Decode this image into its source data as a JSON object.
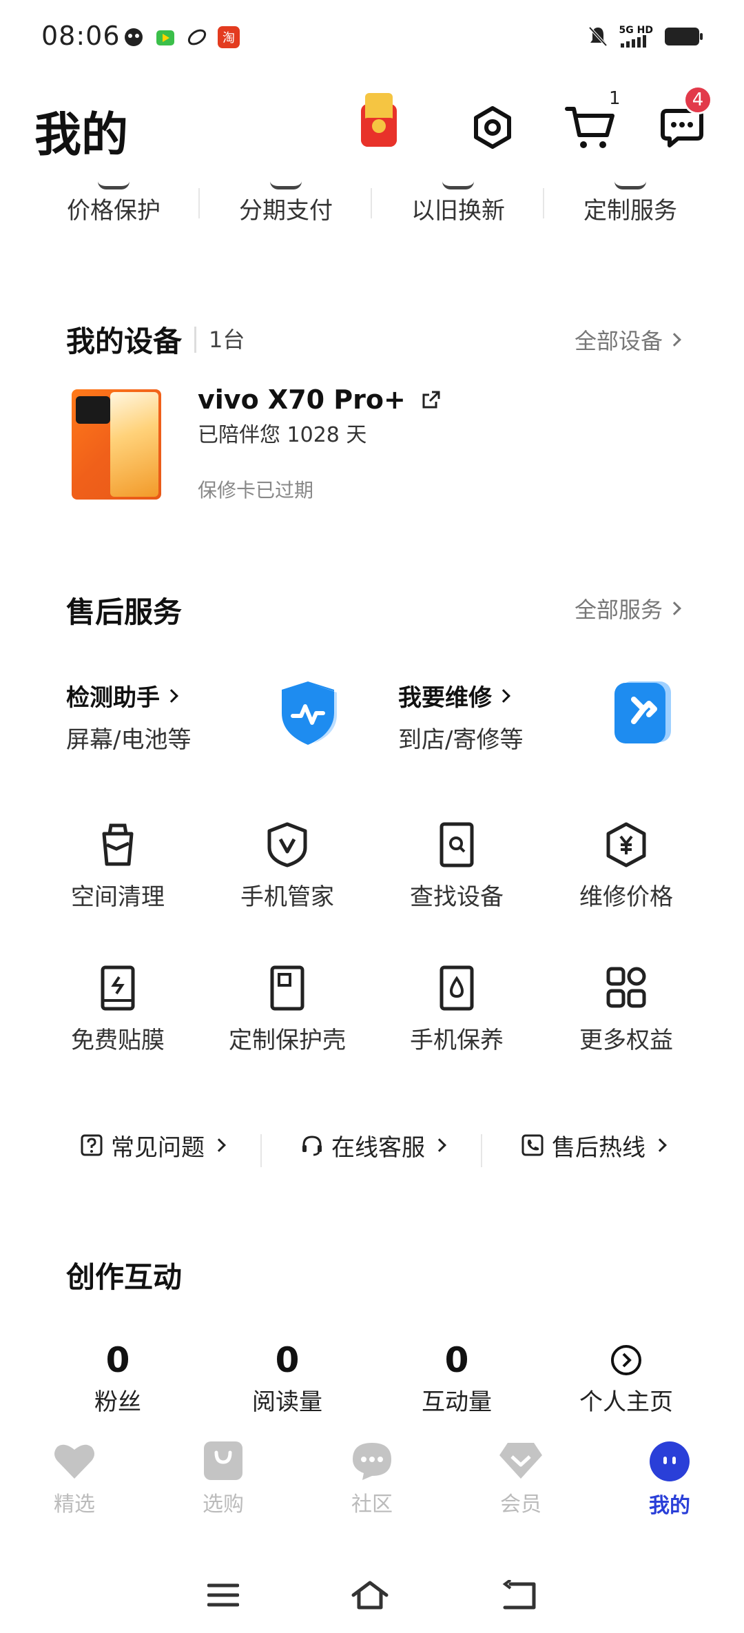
{
  "status_bar": {
    "time": "08:06",
    "network": "5G HD",
    "app_icon_text": "淘"
  },
  "header": {
    "title": "我的",
    "cart_count": "1",
    "message_count": "4"
  },
  "top_services": [
    {
      "label": "价格保护"
    },
    {
      "label": "分期支付"
    },
    {
      "label": "以旧换新"
    },
    {
      "label": "定制服务"
    }
  ],
  "devices": {
    "title": "我的设备",
    "count": "1台",
    "all_label": "全部设备",
    "device": {
      "name": "vivo X70 Pro+",
      "days": "已陪伴您 1028 天",
      "warranty": "保修卡已过期"
    }
  },
  "after_sales": {
    "title": "售后服务",
    "all_label": "全部服务",
    "cards": [
      {
        "title": "检测助手",
        "sub": "屏幕/电池等"
      },
      {
        "title": "我要维修",
        "sub": "到店/寄修等"
      }
    ],
    "grid": [
      {
        "label": "空间清理",
        "icon": "trash-icon"
      },
      {
        "label": "手机管家",
        "icon": "shield-v-icon"
      },
      {
        "label": "查找设备",
        "icon": "find-device-icon"
      },
      {
        "label": "维修价格",
        "icon": "yuan-hex-icon"
      },
      {
        "label": "免费贴膜",
        "icon": "screen-film-icon"
      },
      {
        "label": "定制保护壳",
        "icon": "phone-case-icon"
      },
      {
        "label": "手机保养",
        "icon": "droplet-phone-icon"
      },
      {
        "label": "更多权益",
        "icon": "grid-icon"
      }
    ],
    "help": [
      {
        "label": "常见问题",
        "icon": "question-icon"
      },
      {
        "label": "在线客服",
        "icon": "headset-icon"
      },
      {
        "label": "售后热线",
        "icon": "phone-call-icon"
      }
    ]
  },
  "creation": {
    "title": "创作互动",
    "stats": [
      {
        "value": "0",
        "label": "粉丝"
      },
      {
        "value": "0",
        "label": "阅读量"
      },
      {
        "value": "0",
        "label": "互动量"
      }
    ],
    "home_label": "个人主页"
  },
  "bottom_nav": [
    {
      "label": "精选",
      "icon": "heart-icon",
      "active": false
    },
    {
      "label": "选购",
      "icon": "bag-icon",
      "active": false
    },
    {
      "label": "社区",
      "icon": "chat-bubble-icon",
      "active": false
    },
    {
      "label": "会员",
      "icon": "diamond-icon",
      "active": false
    },
    {
      "label": "我的",
      "icon": "face-icon",
      "active": true
    }
  ],
  "colors": {
    "accent": "#2a3fd8",
    "badge": "#e23a4a",
    "shield_blue": "#1e8cf0",
    "text_gray": "#777777"
  }
}
